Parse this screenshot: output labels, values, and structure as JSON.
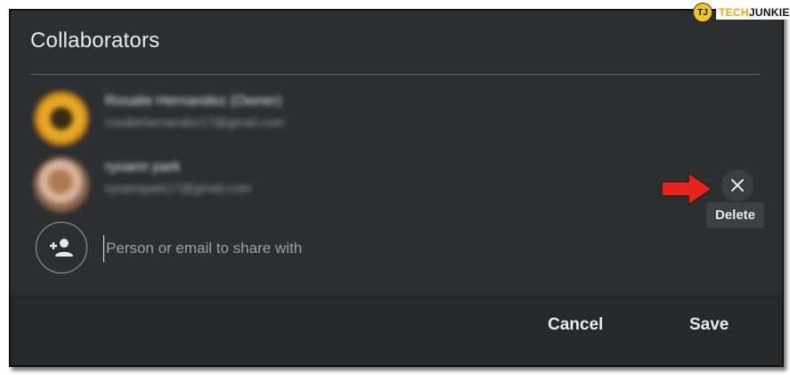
{
  "dialog": {
    "title": "Collaborators",
    "collaborators": [
      {
        "name": "Rosalie Hernandez (Owner)",
        "email": "rosaliehernandez17@gmail.com"
      },
      {
        "name": "ryoann park",
        "email": "ryoannpark17@gmail.com"
      }
    ],
    "share_input": {
      "value": "",
      "placeholder": "Person or email to share with"
    },
    "remove_tooltip": "Delete",
    "buttons": {
      "cancel": "Cancel",
      "save": "Save"
    }
  },
  "watermark": {
    "part1": "TECH",
    "part2": "JUNKIE",
    "logo": "TJ"
  },
  "colors": {
    "dialog_bg": "#2d2e30",
    "footer_bg": "#272829",
    "text_primary": "#e8eaed",
    "text_secondary": "#9aa0a6",
    "annotation_arrow": "#e8231b"
  },
  "icons": {
    "remove": "close-icon",
    "add_person": "person-add-icon",
    "annotation": "red-arrow-icon"
  }
}
